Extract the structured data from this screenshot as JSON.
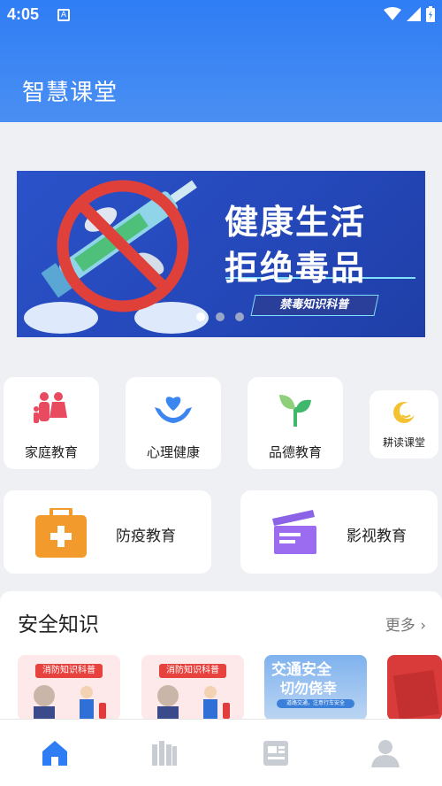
{
  "status_bar": {
    "time": "4:05",
    "notification_icon": "A"
  },
  "header": {
    "title": "智慧课堂"
  },
  "banner": {
    "line1": "健康生活",
    "line2": "拒绝毒品",
    "subtitle": "禁毒知识科普",
    "slide_count": 3,
    "active_slide": 1
  },
  "categories": [
    {
      "label": "家庭教育",
      "icon": "family-icon"
    },
    {
      "label": "心理健康",
      "icon": "heart-hands-icon"
    },
    {
      "label": "品德教育",
      "icon": "sprout-icon"
    },
    {
      "label": "耕读课堂",
      "icon": "moon-logo-icon"
    }
  ],
  "featured": [
    {
      "label": "防疫教育",
      "icon": "first-aid-kit-icon"
    },
    {
      "label": "影视教育",
      "icon": "clapperboard-icon"
    }
  ],
  "safety": {
    "title": "安全知识",
    "more": "更多",
    "cards": [
      {
        "caption": "消防知识科普"
      },
      {
        "caption": "消防知识科普"
      },
      {
        "caption": "交通安全",
        "caption2": "切勿侥幸",
        "note": "道路交通，注意行车安全"
      },
      {
        "caption": ""
      }
    ]
  },
  "tabs": [
    {
      "icon": "home-icon",
      "active": true
    },
    {
      "icon": "library-icon",
      "active": false
    },
    {
      "icon": "news-icon",
      "active": false
    },
    {
      "icon": "user-icon",
      "active": false
    }
  ],
  "colors": {
    "primary": "#2f7df5",
    "tab_inactive": "#c8ccd3"
  }
}
